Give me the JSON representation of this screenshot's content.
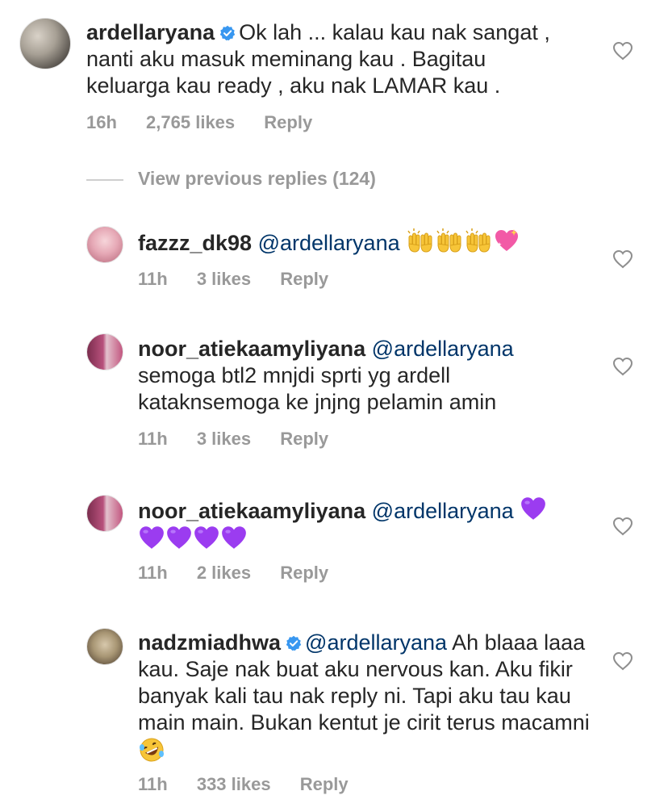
{
  "main_comment": {
    "username": "ardellaryana",
    "verified": true,
    "text": "Ok lah ... kalau kau nak sangat , nanti aku masuk meminang kau . Bagitau keluarga kau ready , aku nak LAMAR kau .",
    "time": "16h",
    "likes": "2,765 likes",
    "reply_label": "Reply"
  },
  "view_previous": "View previous replies (124)",
  "replies": [
    {
      "username": "fazzz_dk98",
      "mention": "@ardellaryana",
      "text": "",
      "emojis": [
        "raising-hands",
        "raising-hands",
        "raising-hands",
        "sparkling-heart"
      ],
      "time": "11h",
      "likes": "3 likes",
      "reply_label": "Reply"
    },
    {
      "username": "noor_atiekaamyliyana",
      "mention": "@ardellaryana",
      "text": "semoga btl2 mnjdi sprti yg ardell kataknsemoga ke jnjng pelamin amin",
      "time": "11h",
      "likes": "3 likes",
      "reply_label": "Reply"
    },
    {
      "username": "noor_atiekaamyliyana",
      "mention": "@ardellaryana",
      "text": "",
      "emojis": [
        "purple-heart",
        "purple-heart",
        "purple-heart",
        "purple-heart",
        "purple-heart"
      ],
      "time": "11h",
      "likes": "2 likes",
      "reply_label": "Reply"
    },
    {
      "username": "nadzmiadhwa",
      "verified": true,
      "mention": "@ardellaryana",
      "text": "Ah blaaa laaa kau. Saje nak buat aku nervous kan. Aku fikir banyak kali tau nak reply ni. Tapi aku tau kau main main. Bukan kentut je cirit terus macamni",
      "emojis": [
        "rofl-face"
      ],
      "time": "11h",
      "likes": "333 likes",
      "reply_label": "Reply"
    }
  ],
  "colors": {
    "text": "#262626",
    "mention": "#003569",
    "meta": "#999999",
    "verified": "#3897f0",
    "purple_heart": "#9b3cf0"
  }
}
